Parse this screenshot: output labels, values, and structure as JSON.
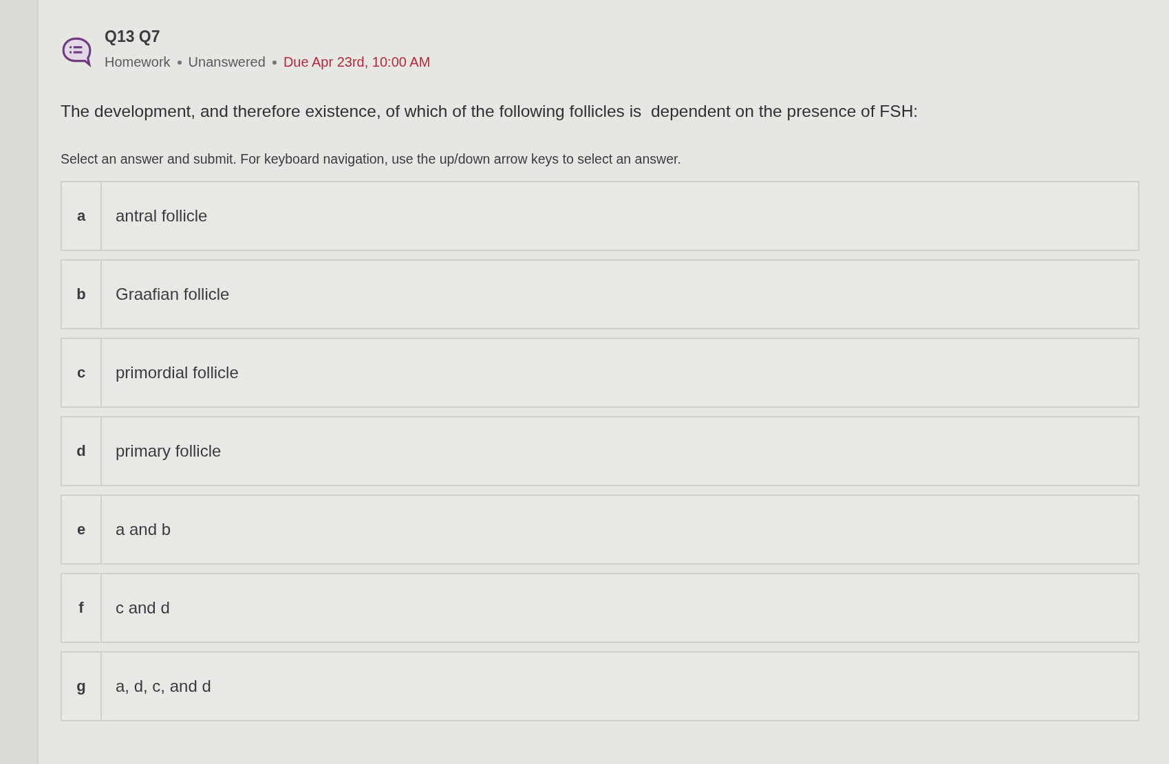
{
  "header": {
    "title": "Q13 Q7",
    "meta": [
      {
        "kind": "plain",
        "text": "Homework"
      },
      {
        "kind": "plain",
        "text": "Unanswered"
      },
      {
        "kind": "due",
        "text": "Due Apr 23rd, 10:00 AM"
      }
    ]
  },
  "question": "The development, and therefore existence, of which of the following follicles is  dependent on the presence of FSH:",
  "instructions": "Select an answer and submit. For keyboard navigation, use the up/down arrow keys to select an answer.",
  "options": [
    {
      "letter": "a",
      "text": "antral follicle",
      "selected": false
    },
    {
      "letter": "b",
      "text": "Graafian follicle",
      "selected": false
    },
    {
      "letter": "c",
      "text": "primordial follicle",
      "selected": false
    },
    {
      "letter": "d",
      "text": "primary follicle",
      "selected": false
    },
    {
      "letter": "e",
      "text": "a and b",
      "selected": false
    },
    {
      "letter": "f",
      "text": "c and d",
      "selected": false
    },
    {
      "letter": "g",
      "text": "a, d, c, and d",
      "selected": false
    }
  ]
}
